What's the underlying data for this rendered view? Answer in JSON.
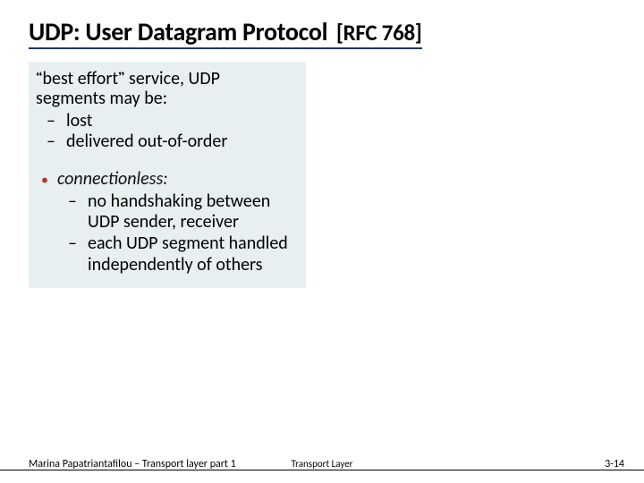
{
  "title": {
    "main": "UDP: User Datagram Protocol",
    "rfc": "[RFC 768]"
  },
  "intro": {
    "q1": "“",
    "q2": "”",
    "phrase": "best effort",
    "rest1": " service, UDP",
    "rest2": "segments may be:"
  },
  "sub1": {
    "a": "lost",
    "b": "delivered out-of-order"
  },
  "bullet2": {
    "head": "connectionless:",
    "items": {
      "a": "no handshaking between UDP sender, receiver",
      "b": "each UDP segment handled independently of others"
    }
  },
  "footer": {
    "left": "Marina Papatriantafilou –  Transport layer part 1",
    "center": "Transport Layer",
    "right": "3-14"
  }
}
